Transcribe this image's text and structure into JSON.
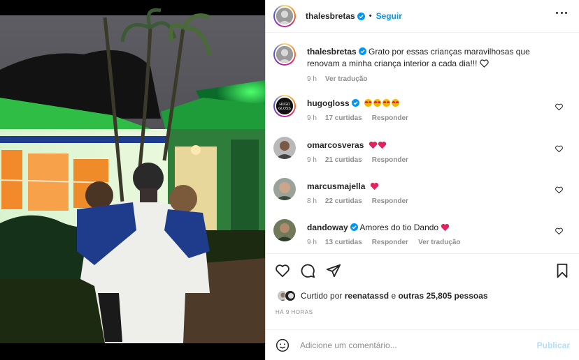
{
  "header": {
    "username": "thalesbretas",
    "separator": "•",
    "follow_label": "Seguir"
  },
  "caption": {
    "username": "thalesbretas",
    "text": "Grato por essas crianças maravilhosas que renovam a minha criança interior a cada dia!!!",
    "time": "9 h",
    "see_translation": "Ver tradução"
  },
  "comments": [
    {
      "username": "hugogloss",
      "text": "",
      "emojis": "star-struck x4",
      "time": "9 h",
      "likes": "17 curtidas",
      "reply": "Responder",
      "translate": ""
    },
    {
      "username": "omarcosveras",
      "text": "",
      "emojis": "red-heart x2",
      "time": "9 h",
      "likes": "21 curtidas",
      "reply": "Responder",
      "translate": ""
    },
    {
      "username": "marcusmajella",
      "text": "",
      "emojis": "red-heart x1",
      "time": "8 h",
      "likes": "22 curtidas",
      "reply": "Responder",
      "translate": ""
    },
    {
      "username": "dandoway",
      "text": "Amores do tio Dando",
      "emojis": "red-heart x1",
      "time": "9 h",
      "likes": "13 curtidas",
      "reply": "Responder",
      "translate": "Ver tradução"
    }
  ],
  "likes": {
    "prefix": "Curtido por",
    "user": "reenatassd",
    "middle": "e",
    "others": "outras 25,805 pessoas"
  },
  "posted_ago": "HÁ 9 HORAS",
  "add_comment": {
    "placeholder": "Adicione um comentário...",
    "publish_label": "Publicar"
  },
  "colors": {
    "accent": "#0095f6",
    "publish_disabled": "#b2dffc",
    "muted": "#8e8e8e",
    "heart_red": "#ed4956"
  },
  "icons": [
    "heart-icon",
    "comment-icon",
    "share-icon",
    "bookmark-icon",
    "emoji-icon",
    "verified-icon",
    "more-icon"
  ]
}
